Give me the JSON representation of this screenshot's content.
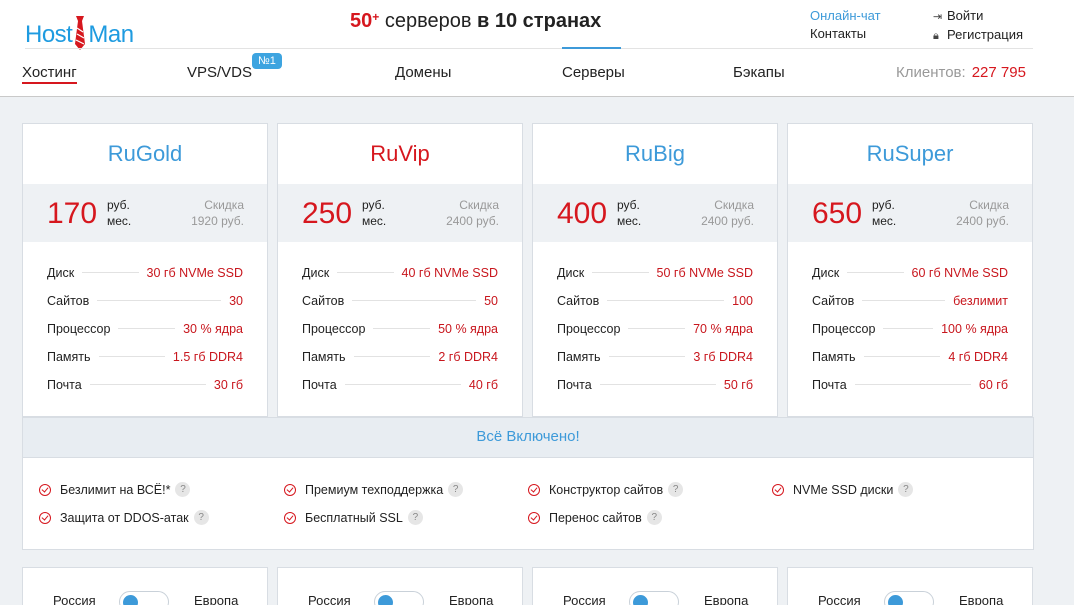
{
  "header": {
    "logo_left": "Host",
    "logo_right": "Man",
    "promo": {
      "count": "50",
      "plus": "+",
      "middle": " серверов ",
      "bold": "в 10 странах"
    },
    "chat_link": "Онлайн-чат",
    "contacts_link": "Контакты",
    "login_link": "Войти",
    "register_link": "Регистрация",
    "nav": [
      "Хостинг",
      "VPS/VDS",
      "Домены",
      "Серверы",
      "Бэкапы"
    ],
    "badge": "№1",
    "clients_label": "Клиентов:",
    "clients_value": "227 795"
  },
  "plans": [
    {
      "name": "RuGold",
      "price": "170",
      "unit_1": "руб.",
      "unit_2": "мес.",
      "discount_label": "Скидка",
      "discount_value": "1920 руб.",
      "specs": [
        [
          "Диск",
          "30 гб NVMe SSD"
        ],
        [
          "Сайтов",
          "30"
        ],
        [
          "Процессор",
          "30 % ядра"
        ],
        [
          "Память",
          "1.5 гб DDR4"
        ],
        [
          "Почта",
          "30 гб"
        ]
      ]
    },
    {
      "name": "RuVip",
      "price": "250",
      "unit_1": "руб.",
      "unit_2": "мес.",
      "discount_label": "Скидка",
      "discount_value": "2400 руб.",
      "specs": [
        [
          "Диск",
          "40 гб NVMe SSD"
        ],
        [
          "Сайтов",
          "50"
        ],
        [
          "Процессор",
          "50 % ядра"
        ],
        [
          "Память",
          "2 гб DDR4"
        ],
        [
          "Почта",
          "40 гб"
        ]
      ]
    },
    {
      "name": "RuBig",
      "price": "400",
      "unit_1": "руб.",
      "unit_2": "мес.",
      "discount_label": "Скидка",
      "discount_value": "2400 руб.",
      "specs": [
        [
          "Диск",
          "50 гб NVMe SSD"
        ],
        [
          "Сайтов",
          "100"
        ],
        [
          "Процессор",
          "70 % ядра"
        ],
        [
          "Память",
          "3 гб DDR4"
        ],
        [
          "Почта",
          "50 гб"
        ]
      ]
    },
    {
      "name": "RuSuper",
      "price": "650",
      "unit_1": "руб.",
      "unit_2": "мес.",
      "discount_label": "Скидка",
      "discount_value": "2400 руб.",
      "specs": [
        [
          "Диск",
          "60 гб NVMe SSD"
        ],
        [
          "Сайтов",
          "безлимит"
        ],
        [
          "Процессор",
          "100 % ядра"
        ],
        [
          "Память",
          "4 гб DDR4"
        ],
        [
          "Почта",
          "60 гб"
        ]
      ]
    }
  ],
  "included": {
    "title": "Всё Включено!",
    "features": [
      "Безлимит на ВСЁ!*",
      "Премиум техподдержка",
      "Конструктор сайтов",
      "NVMe SSD диски",
      "Защита от DDOS-атак",
      "Бесплатный SSL",
      "Перенос сайтов"
    ],
    "help": "?"
  },
  "location_toggle": {
    "left_label": "Россия",
    "right_label": "Европа"
  },
  "colors": {
    "accent_blue": "#3d9ad9",
    "accent_red": "#d6171e",
    "panel_bg": "#eef1f4"
  }
}
